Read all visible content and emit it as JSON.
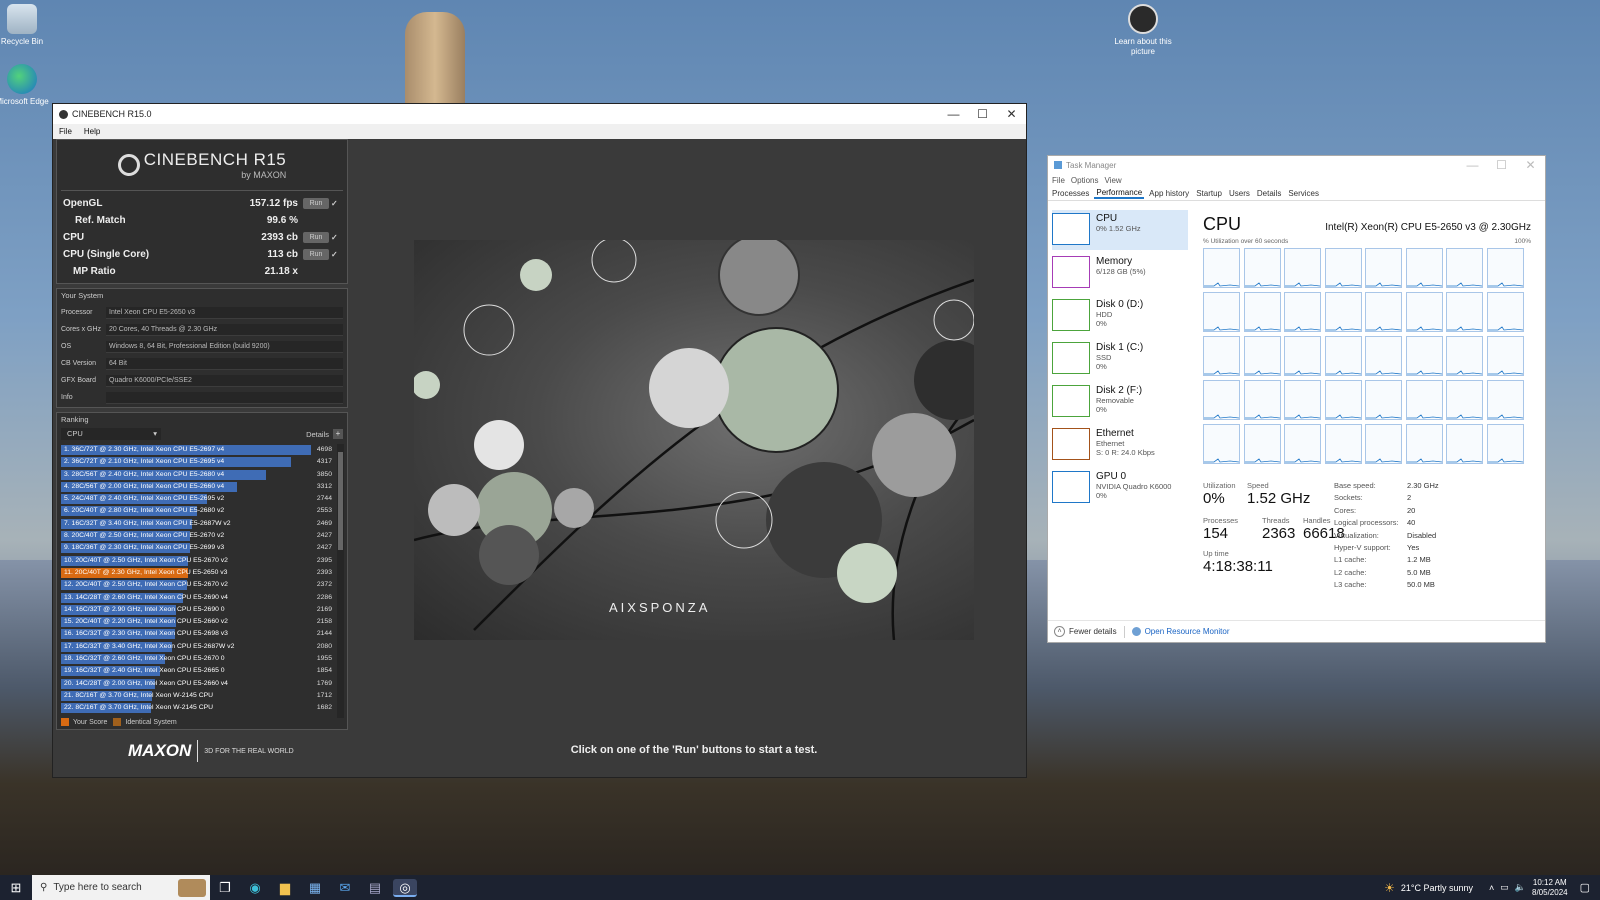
{
  "desktop": {
    "icons": [
      {
        "label": "Recycle Bin"
      },
      {
        "label": "Microsoft Edge"
      },
      {
        "label": "Learn about this picture"
      }
    ]
  },
  "cinebench": {
    "window_title": "CINEBENCH R15.0",
    "menu": [
      "File",
      "Help"
    ],
    "logo_title": "CINEBENCH R15",
    "logo_sub": "by MAXON",
    "results": [
      {
        "label": "OpenGL",
        "value": "157.12 fps",
        "run": "Run",
        "check": "✓"
      },
      {
        "label": "Ref. Match",
        "value": "99.6 %"
      },
      {
        "label": "CPU",
        "value": "2393 cb",
        "run": "Run",
        "check": "✓"
      },
      {
        "label": "CPU (Single Core)",
        "value": "113 cb",
        "run": "Run",
        "check": "✓"
      },
      {
        "label": "MP Ratio",
        "value": "21.18 x"
      }
    ],
    "your_system_title": "Your System",
    "system": [
      {
        "k": "Processor",
        "v": "Intel Xeon CPU E5-2650 v3"
      },
      {
        "k": "Cores x GHz",
        "v": "20 Cores, 40 Threads @ 2.30 GHz"
      },
      {
        "k": "OS",
        "v": "Windows 8, 64 Bit, Professional Edition (build 9200)"
      },
      {
        "k": "CB Version",
        "v": "64 Bit"
      },
      {
        "k": "GFX Board",
        "v": "Quadro K6000/PCIe/SSE2"
      },
      {
        "k": "Info",
        "v": ""
      }
    ],
    "ranking_title": "Ranking",
    "ranking_select": "CPU",
    "details_label": "Details",
    "ranking_max": 4698,
    "ranking": [
      {
        "label": "1. 36C/72T @ 2.30 GHz, Intel Xeon CPU E5-2697 v4",
        "score": 4698
      },
      {
        "label": "2. 36C/72T @ 2.10 GHz, Intel Xeon CPU E5-2695 v4",
        "score": 4317
      },
      {
        "label": "3. 28C/56T @ 2.40 GHz, Intel Xeon CPU E5-2680 v4",
        "score": 3850
      },
      {
        "label": "4. 28C/56T @ 2.00 GHz, Intel Xeon CPU E5-2660 v4",
        "score": 3312
      },
      {
        "label": "5. 24C/48T @ 2.40 GHz,  Intel Xeon CPU E5-2695 v2",
        "score": 2744
      },
      {
        "label": "6. 20C/40T @ 2.80 GHz, Intel Xeon CPU E5-2680 v2",
        "score": 2553
      },
      {
        "label": "7. 16C/32T @ 3.40 GHz, Intel Xeon CPU E5-2687W v2",
        "score": 2469
      },
      {
        "label": "8. 20C/40T @ 2.50 GHz, Intel Xeon CPU E5-2670 v2",
        "score": 2427
      },
      {
        "label": "9. 18C/36T @ 2.30 GHz, Intel Xeon CPU E5-2699 v3",
        "score": 2427
      },
      {
        "label": "10. 20C/40T @ 2.50 GHz,  Intel Xeon CPU E5-2670 v2",
        "score": 2395
      },
      {
        "label": "11. 20C/40T @ 2.30 GHz, Intel Xeon CPU E5-2650 v3",
        "score": 2393,
        "you": true
      },
      {
        "label": "12. 20C/40T @ 2.50 GHz,  Intel Xeon CPU E5-2670 v2",
        "score": 2372
      },
      {
        "label": "13. 14C/28T @ 2.60 GHz, Intel Xeon CPU E5-2690 v4",
        "score": 2286
      },
      {
        "label": "14. 16C/32T @ 2.90 GHz,  Intel Xeon CPU E5-2690 0",
        "score": 2169
      },
      {
        "label": "15. 20C/40T @ 2.20 GHz,  Intel Xeon CPU E5-2660 v2",
        "score": 2158
      },
      {
        "label": "16. 16C/32T @ 2.30 GHz, Intel Xeon CPU E5-2698 v3",
        "score": 2144
      },
      {
        "label": "17. 16C/32T @ 3.40 GHz,  Intel Xeon CPU E5-2687W v2",
        "score": 2080
      },
      {
        "label": "18. 16C/32T @ 2.60 GHz,  Intel Xeon CPU E5-2670 0",
        "score": 1955
      },
      {
        "label": "19. 16C/32T @ 2.40 GHz,  Intel Xeon CPU E5-2665 0",
        "score": 1854
      },
      {
        "label": "20. 14C/28T @ 2.00 GHz, Intel Xeon CPU E5-2660 v4",
        "score": 1769
      },
      {
        "label": "21. 8C/16T @ 3.70 GHz, Intel Xeon W-2145 CPU",
        "score": 1712
      },
      {
        "label": "22. 8C/16T @ 3.70 GHz, Intel Xeon W-2145 CPU",
        "score": 1682
      }
    ],
    "legend_your_score": "Your Score",
    "legend_identical": "Identical System",
    "maxon_logo": "MAXON",
    "maxon_tagline": "3D FOR THE REAL WORLD",
    "render_watermark": "AIXSPONZA",
    "status": "Click on one of the 'Run' buttons to start a test.",
    "colors": {
      "bar": "#3f6cb5",
      "your_score": "#d86a12",
      "identical": "#a0601c"
    }
  },
  "taskmanager": {
    "window_title": "Task Manager",
    "menu": [
      "File",
      "Options",
      "View"
    ],
    "tabs": [
      "Processes",
      "Performance",
      "App history",
      "Startup",
      "Users",
      "Details",
      "Services"
    ],
    "active_tab": "Performance",
    "sidebar": [
      {
        "t1": "CPU",
        "t2": "0% 1.52 GHz",
        "t3": "",
        "color": "#1f77c8"
      },
      {
        "t1": "Memory",
        "t2": "6/128 GB (5%)",
        "t3": "",
        "color": "#a63cb6"
      },
      {
        "t1": "Disk 0 (D:)",
        "t2": "HDD",
        "t3": "0%",
        "color": "#4ca43c"
      },
      {
        "t1": "Disk 1 (C:)",
        "t2": "SSD",
        "t3": "0%",
        "color": "#4ca43c"
      },
      {
        "t1": "Disk 2 (F:)",
        "t2": "Removable",
        "t3": "0%",
        "color": "#4ca43c"
      },
      {
        "t1": "Ethernet",
        "t2": "Ethernet",
        "t3": "S: 0 R: 24.0 Kbps",
        "color": "#a3521a"
      },
      {
        "t1": "GPU 0",
        "t2": "NVIDIA Quadro K6000",
        "t3": "0%",
        "color": "#1f77c8"
      }
    ],
    "header": "CPU",
    "cpu_name": "Intel(R) Xeon(R) CPU E5-2650 v3 @ 2.30GHz",
    "graph_label": "% Utilization over 60 seconds",
    "graph_max": "100%",
    "stats": [
      {
        "label": "Utilization",
        "value": "0%"
      },
      {
        "label": "Speed",
        "value": "1.52 GHz"
      },
      {
        "label": "Processes",
        "value": "154"
      },
      {
        "label": "Threads",
        "value": "2363"
      },
      {
        "label": "Handles",
        "value": "66618"
      },
      {
        "label": "Up time",
        "value": "4:18:38:11"
      }
    ],
    "details": [
      {
        "k": "Base speed:",
        "v": "2.30 GHz"
      },
      {
        "k": "Sockets:",
        "v": "2"
      },
      {
        "k": "Cores:",
        "v": "20"
      },
      {
        "k": "Logical processors:",
        "v": "40"
      },
      {
        "k": "Virtualization:",
        "v": "Disabled"
      },
      {
        "k": "Hyper-V support:",
        "v": "Yes"
      },
      {
        "k": "L1 cache:",
        "v": "1.2 MB"
      },
      {
        "k": "L2 cache:",
        "v": "5.0 MB"
      },
      {
        "k": "L3 cache:",
        "v": "50.0 MB"
      }
    ],
    "fewer_details": "Fewer details",
    "open_resource_monitor": "Open Resource Monitor"
  },
  "taskbar": {
    "search_placeholder": "Type here to search",
    "weather": "21°C  Partly sunny",
    "time": "10:12 AM",
    "date": "8/05/2024"
  }
}
